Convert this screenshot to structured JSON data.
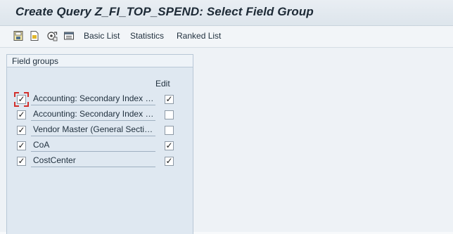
{
  "window": {
    "title": "Create Query Z_FI_TOP_SPEND: Select Field Group"
  },
  "toolbar": {
    "icons": [
      "save-variant-icon",
      "document-icon",
      "gear-refresh-icon",
      "list-layout-icon"
    ],
    "basic_list": "Basic List",
    "statistics": "Statistics",
    "ranked_list": "Ranked List"
  },
  "panel": {
    "title": "Field groups",
    "edit_header": "Edit",
    "rows": [
      {
        "name": "Accounting: Secondary Index for Customers",
        "selected": true,
        "edit": true
      },
      {
        "name": "Accounting: Secondary Index for Customers (Cleared Items)",
        "selected": true,
        "edit": false
      },
      {
        "name": "Vendor Master (General Section)",
        "selected": true,
        "edit": false
      },
      {
        "name": "CoA",
        "selected": true,
        "edit": true
      },
      {
        "name": "CostCenter",
        "selected": true,
        "edit": true
      }
    ]
  },
  "colors": {
    "focus": "#d2302b",
    "panel_bg": "#dfe8f1"
  }
}
